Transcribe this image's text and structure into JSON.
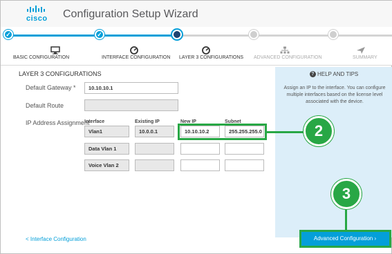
{
  "app": {
    "logo_text": "cisco",
    "title": "Configuration Setup Wizard"
  },
  "steps": [
    {
      "label": "BASIC CONFIGURATION",
      "state": "done",
      "icon": "monitor-icon"
    },
    {
      "label": "INTERFACE CONFIGURATION",
      "state": "done",
      "icon": "gauge-icon"
    },
    {
      "label": "LAYER 3 CONFIGURATIONS",
      "state": "current",
      "icon": "gauge-icon"
    },
    {
      "label": "ADVANCED CONFIGURATION",
      "state": "pending",
      "icon": "network-icon"
    },
    {
      "label": "SUMMARY",
      "state": "pending",
      "icon": "send-icon"
    }
  ],
  "colors": {
    "accent": "#049fd9",
    "current": "#1e4471",
    "pending": "#cfcfcf",
    "highlight": "#28a745",
    "help_bg": "#dceef9"
  },
  "form": {
    "section_title": "LAYER 3 CONFIGURATIONS",
    "default_gateway": {
      "label": "Default Gateway *",
      "value": "10.10.10.1"
    },
    "default_route": {
      "label": "Default Route",
      "value": ""
    },
    "ip_assignment": {
      "label": "IP Address Assignment",
      "headers": {
        "interface": "Interface",
        "existing_ip": "Existing IP",
        "new_ip": "New IP",
        "subnet": "Subnet"
      },
      "rows": [
        {
          "interface": "Vlan1",
          "existing_ip": "10.0.0.1",
          "new_ip": "10.10.10.2",
          "subnet": "255.255.255.0"
        },
        {
          "interface": "Data Vlan 1",
          "existing_ip": "",
          "new_ip": "",
          "subnet": ""
        },
        {
          "interface": "Voice Vlan 2",
          "existing_ip": "",
          "new_ip": "",
          "subnet": ""
        }
      ]
    }
  },
  "help": {
    "icon": "question-circle-icon",
    "title": "HELP AND TIPS",
    "body": "Assign an IP to the interface. You can configure multiple interfaces based on the license level associated with the device."
  },
  "footer": {
    "back_label": "< Interface Configuration",
    "next_label": "Advanced Configuration ›"
  },
  "callouts": {
    "two": "2",
    "three": "3"
  }
}
